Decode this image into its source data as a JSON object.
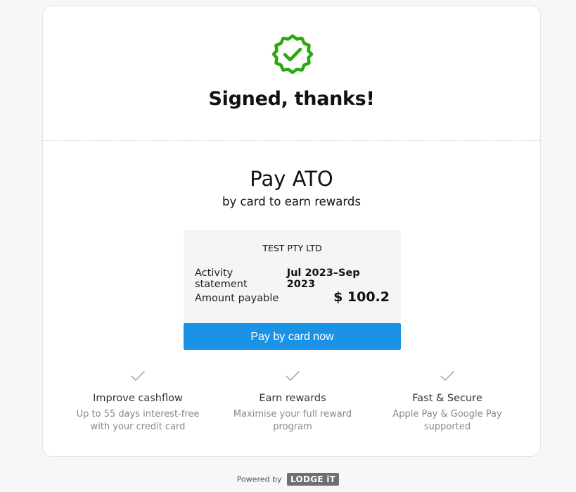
{
  "signed": {
    "title": "Signed, thanks!"
  },
  "pay": {
    "title": "Pay ATO",
    "subtitle": "by card to earn rewards"
  },
  "summary": {
    "company": "TEST PTY LTD",
    "activity_label": "Activity statement",
    "activity_value": "Jul 2023–Sep 2023",
    "amount_label": "Amount payable",
    "amount_value": "$ 100.2"
  },
  "button": {
    "label": "Pay by card now"
  },
  "features": [
    {
      "icon": "checkmark-icon",
      "title": "Improve cashflow",
      "description": "Up to 55 days interest-free with your credit card"
    },
    {
      "icon": "checkmark-icon",
      "title": "Earn rewards",
      "description": "Maximise your full reward program"
    },
    {
      "icon": "checkmark-icon",
      "title": "Fast & Secure",
      "description": "Apple Pay & Google Pay supported"
    }
  ],
  "footer": {
    "powered_by": "Powered by",
    "logo_text": "LODGE iT"
  },
  "colors": {
    "success_green": "#2aa90e",
    "button_blue": "#1a93e6",
    "check_gray": "#a9adb1"
  }
}
